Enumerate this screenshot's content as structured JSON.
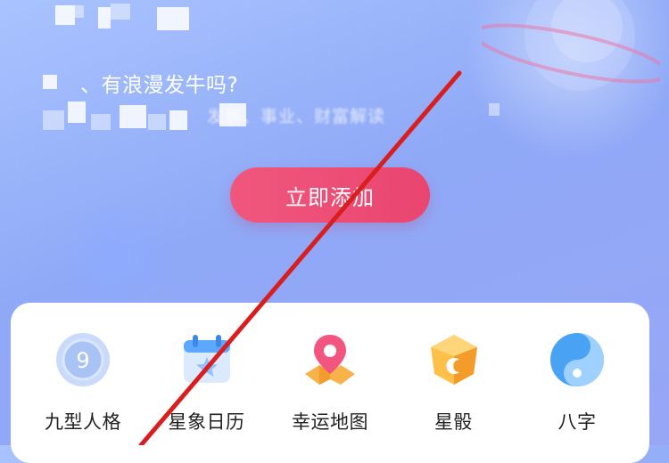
{
  "hero": {
    "headline": "、有浪漫发牛吗?",
    "subline_partial": "发展、事业、财富解读",
    "cta_label": "立即添加"
  },
  "tools": [
    {
      "label": "九型人格",
      "icon": "enneagram-icon",
      "color": "#8fb3ef"
    },
    {
      "label": "星象日历",
      "icon": "calendar-star-icon",
      "color": "#5da8ff"
    },
    {
      "label": "幸运地图",
      "icon": "map-pin-icon",
      "color": "#f6a23a"
    },
    {
      "label": "星骰",
      "icon": "dice-icon",
      "color": "#ffb640"
    },
    {
      "label": "八字",
      "icon": "bazi-icon",
      "color": "#4aa2f5"
    }
  ],
  "colors": {
    "cta": "#ee4f77",
    "arrow": "#d81e1e",
    "background": "#96aff8"
  }
}
